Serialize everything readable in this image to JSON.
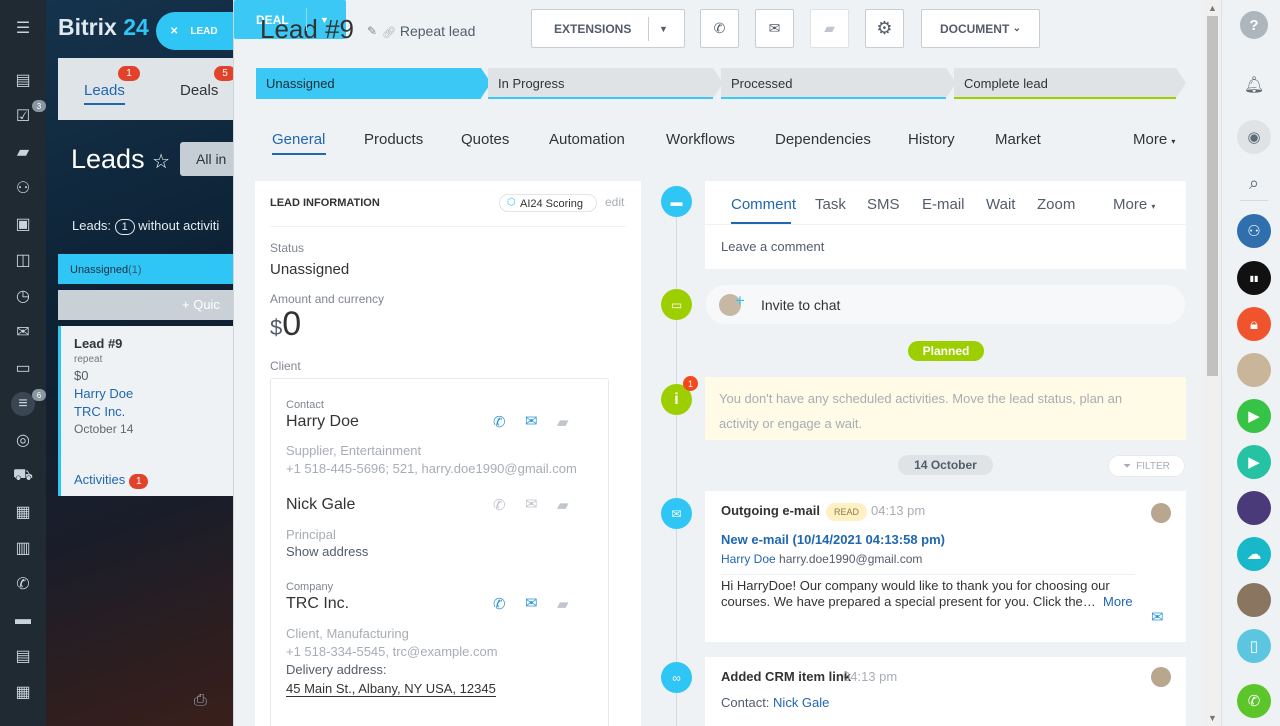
{
  "brand": {
    "name": "Bitrix",
    "suffix": "24"
  },
  "background": {
    "lead_chip": "LEAD",
    "tabs": [
      {
        "label": "Leads",
        "count": "1"
      },
      {
        "label": "Deals",
        "count": "5"
      }
    ],
    "page_title": "Leads",
    "filter_label": "All in",
    "leads_line": {
      "prefix": "Leads:",
      "count": "1",
      "suffix": "without activiti"
    },
    "stage_label": "Unassigned",
    "stage_count": "(1)",
    "quick_label": "+ Quic",
    "card": {
      "title": "Lead #9",
      "subtitle": "repeat",
      "amount": "$0",
      "contact": "Harry Doe",
      "company": "TRC Inc.",
      "date": "October 14",
      "activities_label": "Activities",
      "activities_count": "1"
    },
    "left_nav_badges": [
      "3",
      "6"
    ]
  },
  "header": {
    "title": "Lead #9",
    "repeat": "Repeat lead",
    "extensions": "EXTENSIONS",
    "document": "DOCUMENT",
    "deal": "DEAL"
  },
  "stages": [
    {
      "label": "Unassigned",
      "color": "#3bc8f5"
    },
    {
      "label": "In Progress",
      "color": "#dfe3e6"
    },
    {
      "label": "Processed",
      "color": "#dfe3e6"
    },
    {
      "label": "Complete lead",
      "color": "#dfe3e6"
    }
  ],
  "tabs": [
    "General",
    "Products",
    "Quotes",
    "Automation",
    "Workflows",
    "Dependencies",
    "History",
    "Market",
    "More"
  ],
  "lead_info": {
    "heading": "LEAD INFORMATION",
    "ai_scoring": "AI24 Scoring",
    "edit": "edit",
    "status_label": "Status",
    "status_value": "Unassigned",
    "amount_label": "Amount and currency",
    "currency": "$",
    "amount": "0",
    "client_label": "Client",
    "contact_label": "Contact",
    "contact1_name": "Harry Doe",
    "contact1_type": "Supplier, Entertainment",
    "contact1_phone": "+1 518-445-5696; 521, harry.doe1990@gmail.com",
    "contact2_name": "Nick Gale",
    "contact2_role": "Principal",
    "contact2_addr": "Show address",
    "company_label": "Company",
    "company_name": "TRC Inc.",
    "company_type": "Client, Manufacturing",
    "company_phone": "+1 518-334-5545, trc@example.com",
    "delivery_label": "Delivery address:",
    "delivery_value": "45 Main St., Albany, NY USA, 12345"
  },
  "timeline": {
    "comment_tabs": [
      "Comment",
      "Task",
      "SMS",
      "E-mail",
      "Wait",
      "Zoom",
      "More"
    ],
    "leave_comment": "Leave a comment",
    "invite": "Invite to chat",
    "planned": "Planned",
    "no_activities": "You don't have any scheduled activities. Move the lead status, plan an activity or engage a wait.",
    "notice_count": "1",
    "date": "14 October",
    "filter": "FILTER",
    "email": {
      "title": "Outgoing e-mail",
      "badge": "READ",
      "time": "04:13 pm",
      "subject": "New e-mail (10/14/2021 04:13:58 pm)",
      "from_name": "Harry Doe",
      "from_email": "harry.doe1990@gmail.com",
      "body": "Hi HarryDoe! Our company would like to thank you for choosing our courses. We have prepared a special  present for you. Click the…",
      "more": "More"
    },
    "link": {
      "title": "Added CRM item link",
      "time": "04:13 pm",
      "contact_label": "Contact:",
      "contact_name": "Nick Gale"
    }
  },
  "right_bar": {
    "help": "?"
  }
}
